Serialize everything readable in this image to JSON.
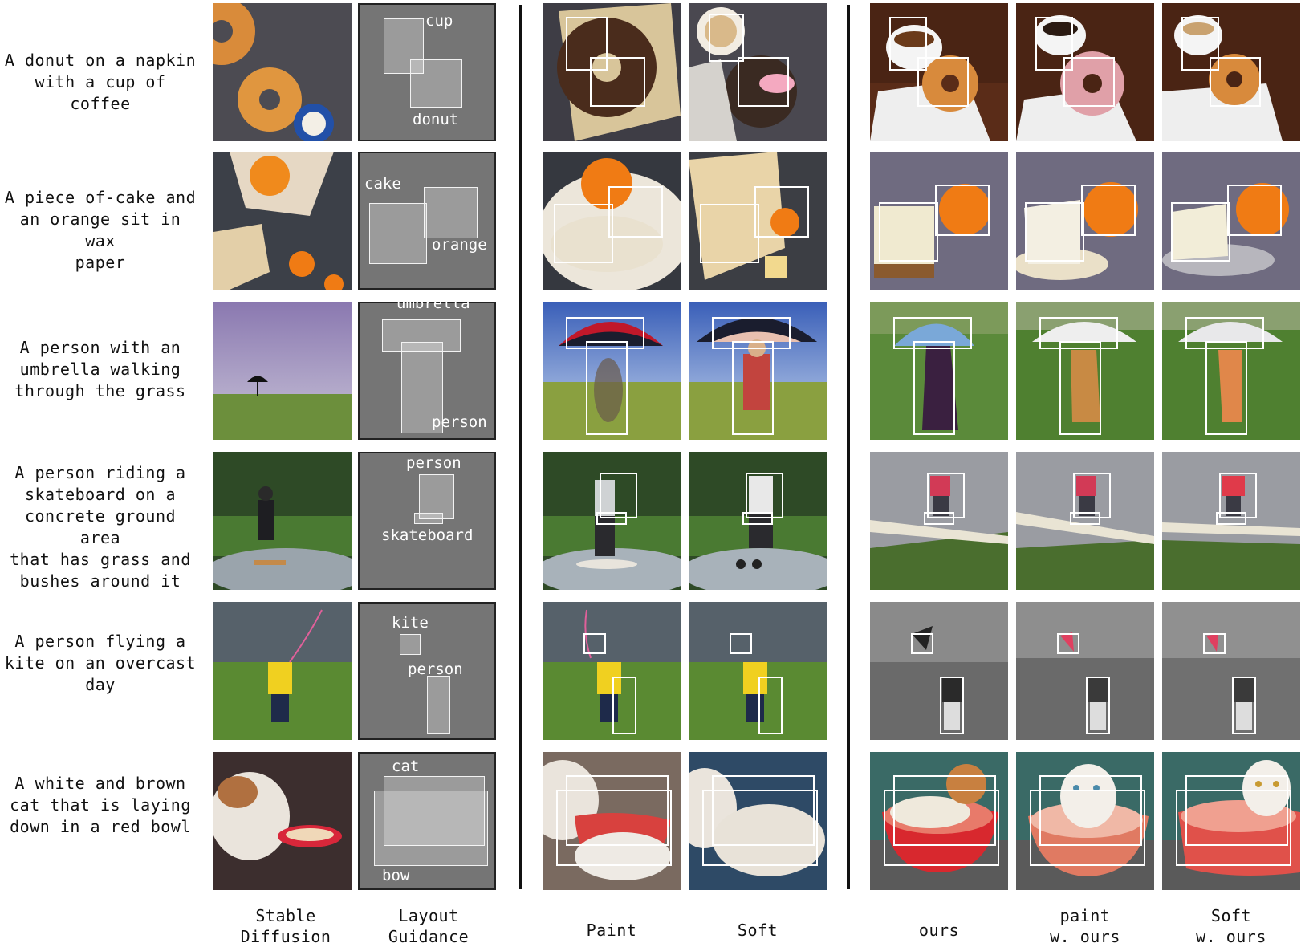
{
  "rows": [
    {
      "prompt": "A donut on a napkin\nwith a cup of coffee",
      "labels": [
        "cup",
        "donut"
      ]
    },
    {
      "prompt": "A piece of-cake and\nan orange sit in wax\npaper",
      "labels": [
        "cake",
        "orange"
      ]
    },
    {
      "prompt": "A person with an\numbrella walking\nthrough the grass",
      "labels": [
        "umbrella",
        "person"
      ]
    },
    {
      "prompt": "A person riding a\nskateboard on a\nconcrete ground area\nthat has grass and\nbushes around it",
      "labels": [
        "person",
        "skateboard"
      ]
    },
    {
      "prompt": "A person flying a\nkite on an overcast\nday",
      "labels": [
        "kite",
        "person"
      ]
    },
    {
      "prompt": "A white and brown\ncat that is laying\ndown in a red bowl",
      "labels": [
        "cat",
        "bow"
      ]
    }
  ],
  "columns": {
    "stable_diffusion": "Stable\nDiffusion",
    "layout_guidance": "Layout\nGuidance",
    "paint": "Paint",
    "soft": "Soft",
    "ours": "ours",
    "paint_w_ours": "paint\nw. ours",
    "soft_w_ours": "Soft\nw. ours"
  },
  "colors": {
    "layout_bg": "#757575",
    "box_stroke": "#ffffff",
    "divider": "#111111"
  }
}
